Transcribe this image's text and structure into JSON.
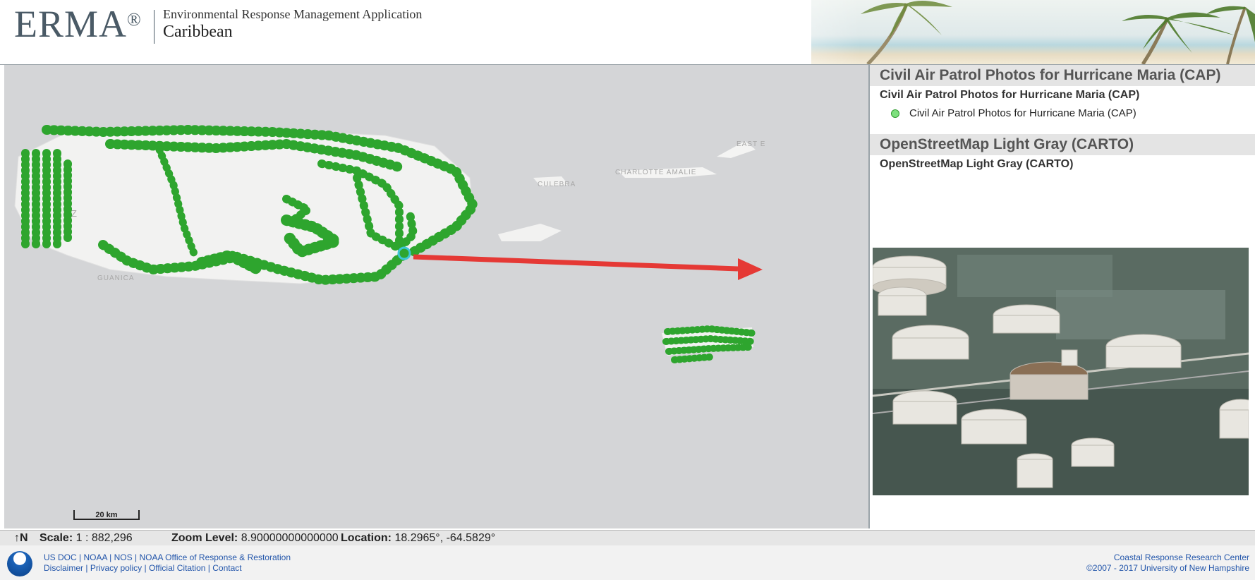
{
  "app": {
    "logo_text": "ERMA",
    "logo_mark": "®",
    "subtitle": "Environmental Response Management Application",
    "region": "Caribbean"
  },
  "map": {
    "labels": {
      "culebra": "CULEBRA",
      "charlotte_amalie": "CHARLOTTE AMALIE",
      "east_end": "EAST E",
      "guanica": "GUANICA",
      "mayaguez": "Z"
    },
    "scale_bar": "20 km",
    "marker_color": "#2ea52e",
    "marker_outline": "#1a7a1a",
    "selected_color": "#3dc6d6",
    "arrow_color": "#e53935"
  },
  "panel": {
    "layer1_header": "Civil Air Patrol Photos for Hurricane Maria (CAP)",
    "layer1_title": "Civil Air Patrol Photos for Hurricane Maria (CAP)",
    "layer1_legend": "Civil Air Patrol Photos for Hurricane Maria (CAP)",
    "layer2_header": "OpenStreetMap Light Gray (CARTO)",
    "layer2_title": "OpenStreetMap Light Gray (CARTO)"
  },
  "status": {
    "north_icon": "north-arrow-icon",
    "north_text": "↑N",
    "scale_label": "Scale:",
    "scale_value": "1 : 882,296",
    "zoom_label": "Zoom Level:",
    "zoom_value": "8.90000000000000",
    "location_label": "Location:",
    "location_value": "18.2965°, -64.5829°"
  },
  "footer": {
    "links1": [
      "US DOC",
      "NOAA",
      "NOS",
      "NOAA Office of Response & Restoration"
    ],
    "links2": [
      "Disclaimer",
      "Privacy policy",
      "Official Citation",
      "Contact"
    ],
    "right1": "Coastal Response Research Center",
    "right2": "©2007 - 2017 University of New Hampshire"
  }
}
